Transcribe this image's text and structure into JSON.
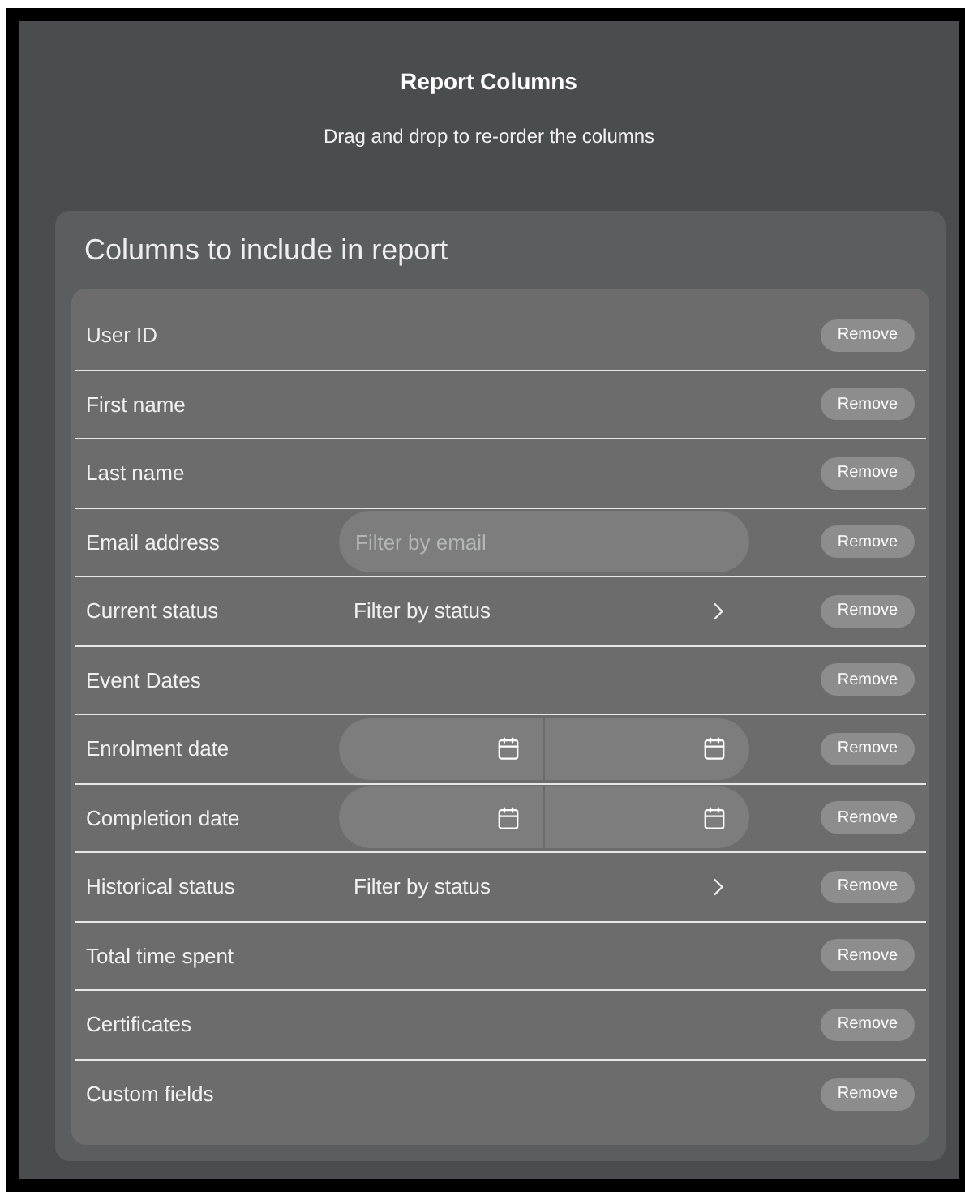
{
  "dialog": {
    "title": "Report Columns",
    "subtitle": "Drag and drop to re-order the columns"
  },
  "panel": {
    "heading": "Columns to include in report",
    "columns": [
      {
        "label": "User ID",
        "kind": "plain",
        "button": "Remove"
      },
      {
        "label": "First name",
        "kind": "plain",
        "button": "Remove"
      },
      {
        "label": "Last name",
        "kind": "plain",
        "button": "Remove"
      },
      {
        "label": "Email address",
        "kind": "text",
        "placeholder": "Filter by email",
        "button": "Remove"
      },
      {
        "label": "Current status",
        "kind": "select",
        "value": "Filter by status",
        "button": "Remove"
      },
      {
        "label": "Event Dates",
        "kind": "plain",
        "button": "Remove"
      },
      {
        "label": "Enrolment date",
        "kind": "daterange",
        "button": "Remove"
      },
      {
        "label": "Completion date",
        "kind": "daterange",
        "button": "Remove"
      },
      {
        "label": "Historical status",
        "kind": "select",
        "value": "Filter by status",
        "button": "Remove"
      },
      {
        "label": "Total time spent",
        "kind": "plain",
        "button": "Remove"
      },
      {
        "label": "Certificates",
        "kind": "plain",
        "button": "Remove"
      },
      {
        "label": "Custom fields",
        "kind": "plain",
        "button": "Remove"
      }
    ]
  }
}
